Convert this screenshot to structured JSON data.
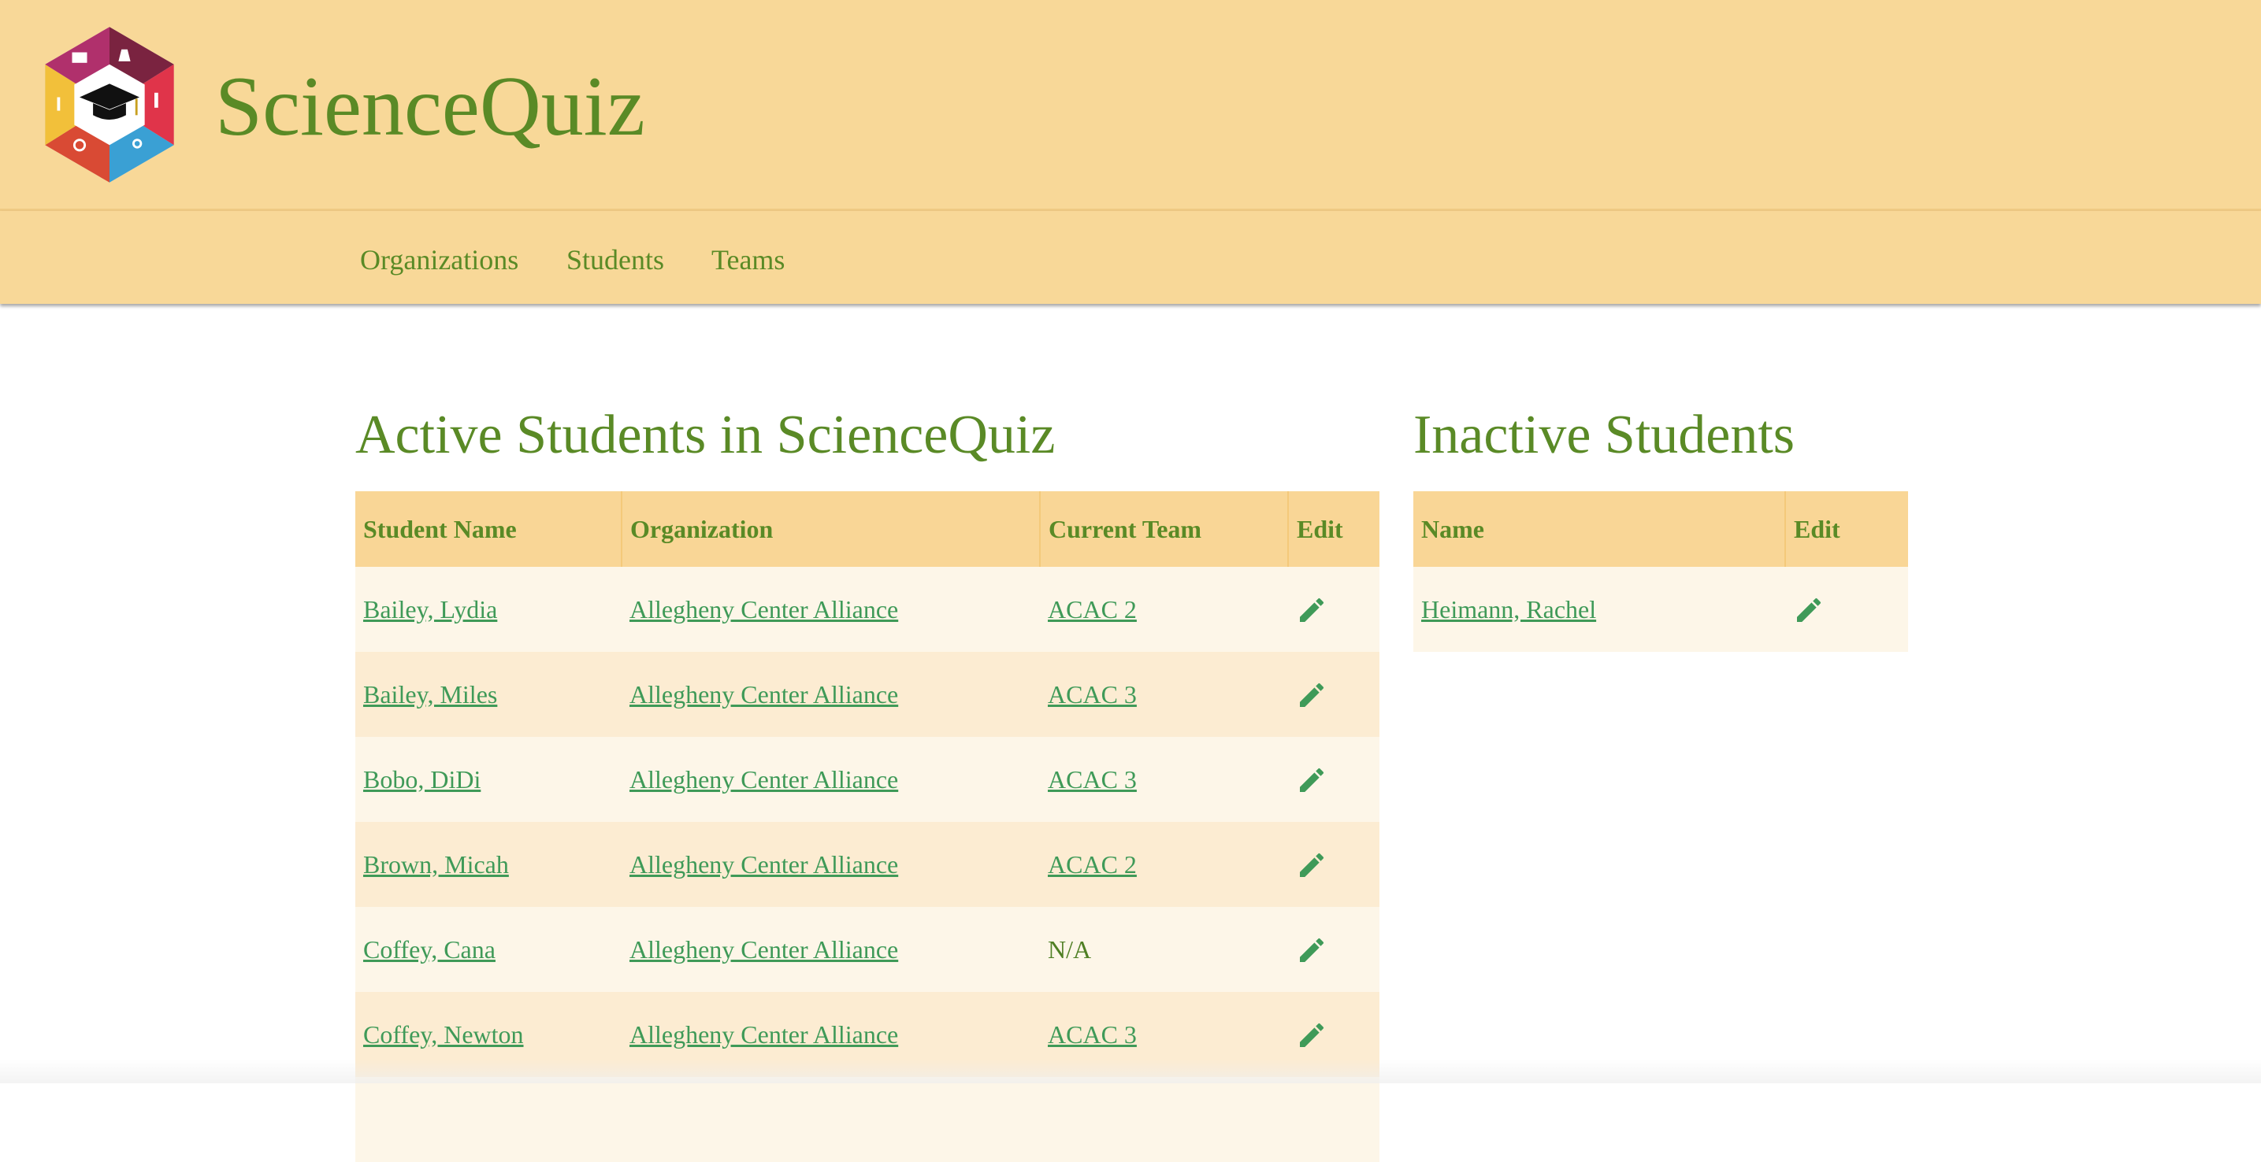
{
  "app": {
    "title": "ScienceQuiz"
  },
  "nav": [
    {
      "label": "Organizations"
    },
    {
      "label": "Students"
    },
    {
      "label": "Teams"
    }
  ],
  "active": {
    "title": "Active Students in ScienceQuiz",
    "headers": {
      "name": "Student Name",
      "org": "Organization",
      "team": "Current Team",
      "edit": "Edit"
    },
    "rows": [
      {
        "name": "Bailey, Lydia",
        "org": "Allegheny Center Alliance",
        "team": "ACAC 2"
      },
      {
        "name": "Bailey, Miles",
        "org": "Allegheny Center Alliance",
        "team": "ACAC 3"
      },
      {
        "name": "Bobo, DiDi",
        "org": "Allegheny Center Alliance",
        "team": "ACAC 3"
      },
      {
        "name": "Brown, Micah",
        "org": "Allegheny Center Alliance",
        "team": "ACAC 2"
      },
      {
        "name": "Coffey, Cana",
        "org": "Allegheny Center Alliance",
        "team": "N/A"
      },
      {
        "name": "Coffey, Newton",
        "org": "Allegheny Center Alliance",
        "team": "ACAC 3"
      }
    ]
  },
  "inactive": {
    "title": "Inactive Students",
    "headers": {
      "name": "Name",
      "edit": "Edit"
    },
    "rows": [
      {
        "name": "Heimann, Rachel"
      }
    ]
  },
  "icons": {
    "edit": "pencil-icon",
    "logo": "sciencequiz-hexagon-logo"
  },
  "colors": {
    "header_bg": "#f8d898",
    "title_green": "#5a8a26",
    "link_green": "#3f9a58",
    "table_header": "#f9d696"
  }
}
